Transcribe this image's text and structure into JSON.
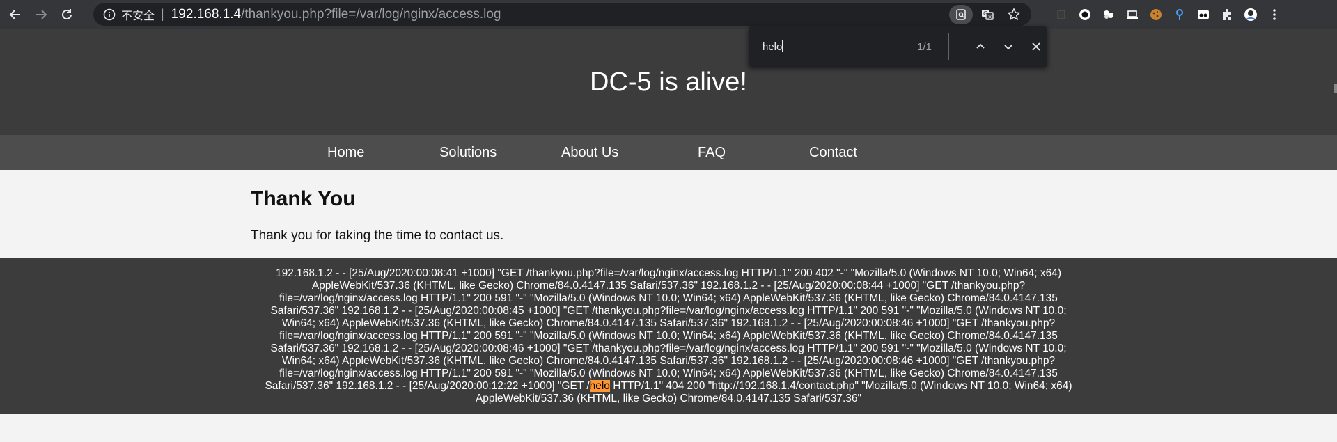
{
  "browser": {
    "security_label": "不安全",
    "separator": "|",
    "url_host": "192.168.1.4",
    "url_path": "/thankyou.php?file=/var/log/nginx/access.log",
    "icons": [
      "back-arrow-icon",
      "forward-arrow-icon",
      "reload-icon",
      "info-icon",
      "search-page-icon",
      "translate-icon",
      "star-icon",
      "extensions-icon",
      "profile-avatar",
      "menu-dots-icon"
    ]
  },
  "findbar": {
    "query": "helo",
    "count": "1/1"
  },
  "site": {
    "title": "DC-5 is alive!",
    "nav": [
      "Home",
      "Solutions",
      "About Us",
      "FAQ",
      "Contact"
    ]
  },
  "content": {
    "heading": "Thank You",
    "message": "Thank you for taking the time to contact us."
  },
  "log": {
    "lines": [
      "192.168.1.2 - - [25/Aug/2020:00:08:41 +1000] \"GET /thankyou.php?file=/var/log/nginx/access.log HTTP/1.1\" 200 402 \"-\" \"Mozilla/5.0 (Windows NT 10.0; Win64; x64)",
      "AppleWebKit/537.36 (KHTML, like Gecko) Chrome/84.0.4147.135 Safari/537.36\" 192.168.1.2 - - [25/Aug/2020:00:08:44 +1000] \"GET /thankyou.php?",
      "file=/var/log/nginx/access.log HTTP/1.1\" 200 591 \"-\" \"Mozilla/5.0 (Windows NT 10.0; Win64; x64) AppleWebKit/537.36 (KHTML, like Gecko) Chrome/84.0.4147.135",
      "Safari/537.36\" 192.168.1.2 - - [25/Aug/2020:00:08:45 +1000] \"GET /thankyou.php?file=/var/log/nginx/access.log HTTP/1.1\" 200 591 \"-\" \"Mozilla/5.0 (Windows NT 10.0;",
      "Win64; x64) AppleWebKit/537.36 (KHTML, like Gecko) Chrome/84.0.4147.135 Safari/537.36\" 192.168.1.2 - - [25/Aug/2020:00:08:46 +1000] \"GET /thankyou.php?",
      "file=/var/log/nginx/access.log HTTP/1.1\" 200 591 \"-\" \"Mozilla/5.0 (Windows NT 10.0; Win64; x64) AppleWebKit/537.36 (KHTML, like Gecko) Chrome/84.0.4147.135",
      "Safari/537.36\" 192.168.1.2 - - [25/Aug/2020:00:08:46 +1000] \"GET /thankyou.php?file=/var/log/nginx/access.log HTTP/1.1\" 200 591 \"-\" \"Mozilla/5.0 (Windows NT 10.0;",
      "Win64; x64) AppleWebKit/537.36 (KHTML, like Gecko) Chrome/84.0.4147.135 Safari/537.36\" 192.168.1.2 - - [25/Aug/2020:00:08:46 +1000] \"GET /thankyou.php?",
      "file=/var/log/nginx/access.log HTTP/1.1\" 200 591 \"-\" \"Mozilla/5.0 (Windows NT 10.0; Win64; x64) AppleWebKit/537.36 (KHTML, like Gecko) Chrome/84.0.4147.135"
    ],
    "last_before": "Safari/537.36\" 192.168.1.2 - - [25/Aug/2020:00:12:22 +1000] \"GET /",
    "last_highlight": "helo",
    "last_after": " HTTP/1.1\" 404 200 \"http://192.168.1.4/contact.php\" \"Mozilla/5.0 (Windows NT 10.0; Win64; x64)",
    "final_line": "AppleWebKit/537.36 (KHTML, like Gecko) Chrome/84.0.4147.135 Safari/537.36\"",
    "highlight_color": "#ff9632"
  },
  "colors": {
    "chrome_bg": "#35363a",
    "omnibox_bg": "#202124",
    "site_header_bg": "#3c3c3c",
    "site_nav_bg": "#4d4d4d",
    "page_bg": "#f3f3f3"
  }
}
